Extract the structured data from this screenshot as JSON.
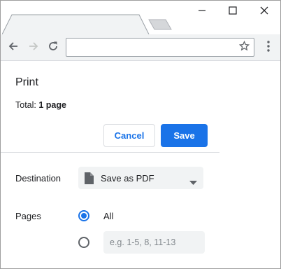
{
  "browser": {
    "address_value": "",
    "icons": {
      "back": "arrow-left-icon",
      "forward": "arrow-right-icon",
      "reload": "reload-icon",
      "bookmark": "star-icon",
      "menu": "kebab-menu-icon",
      "minimize": "minimize-icon",
      "maximize": "maximize-icon",
      "close": "close-icon"
    }
  },
  "print": {
    "title": "Print",
    "total_label": "Total: ",
    "total_value": "1 page",
    "cancel_label": "Cancel",
    "save_label": "Save",
    "destination_label": "Destination",
    "destination_value": "Save as PDF",
    "pages_label": "Pages",
    "pages_all_label": "All",
    "pages_all_selected": true,
    "pages_custom_placeholder": "e.g. 1-5, 8, 11-13",
    "pages_custom_value": ""
  },
  "colors": {
    "accent": "#1a73e8",
    "toolbar_bg": "#f1f3f4",
    "field_bg": "#f1f3f4",
    "divider": "#dadce0"
  }
}
